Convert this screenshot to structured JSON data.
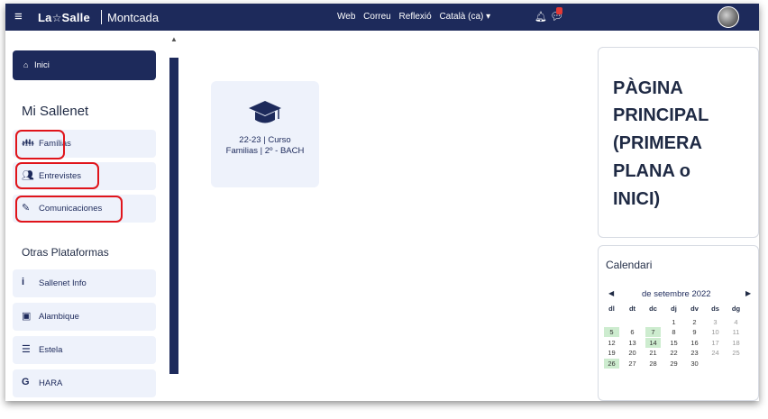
{
  "topbar": {
    "menu_icon": "hamburger-icon",
    "logo_prefix": "La",
    "logo_star": "☆",
    "logo_suffix": "Salle",
    "brand": "Montcada",
    "nav": [
      "Web",
      "Correu",
      "Reflexió",
      "Català (ca) ▾"
    ],
    "bell_icon": "bell-icon",
    "message_icon": "chat-icon",
    "accent": "#1d2a5b"
  },
  "sidebar": {
    "home": {
      "label": "Inici",
      "icon": "home-icon"
    },
    "section1_title": "Mi Sallenet",
    "section1_items": [
      {
        "label": "Famílias",
        "icon": "family-icon"
      },
      {
        "label": "Entrevistes",
        "icon": "people-icon"
      },
      {
        "label": "Comunicaciones",
        "icon": "communication-icon"
      }
    ],
    "section2_title": "Otras Plataformas",
    "section2_items": [
      {
        "label": "Sallenet Info",
        "icon": "info-icon"
      },
      {
        "label": "Alambique",
        "icon": "alambique-icon"
      },
      {
        "label": "Estela",
        "icon": "estela-icon"
      },
      {
        "label": "HARA",
        "icon": "hara-icon"
      }
    ],
    "highlight_color": "#e0141b"
  },
  "course": {
    "line1": "22-23 | Curso",
    "line2": "Familias | 2º - BACH",
    "icon": "graduation-cap-icon"
  },
  "title_panel": {
    "lines": [
      "PÀGINA",
      "PRINCIPAL",
      "(PRIMERA",
      "PLANA o",
      "INICI)"
    ]
  },
  "calendar": {
    "title": "Calendari",
    "month": "de setembre 2022",
    "weekdays": [
      "dl",
      "dt",
      "dc",
      "dj",
      "dv",
      "ds",
      "dg"
    ],
    "weeks": [
      [
        "",
        "",
        "",
        "1",
        "2",
        "3",
        "4"
      ],
      [
        "5",
        "6",
        "7",
        "8",
        "9",
        "10",
        "11"
      ],
      [
        "12",
        "13",
        "14",
        "15",
        "16",
        "17",
        "18"
      ],
      [
        "19",
        "20",
        "21",
        "22",
        "23",
        "24",
        "25"
      ],
      [
        "26",
        "27",
        "28",
        "29",
        "30",
        "",
        ""
      ]
    ],
    "highlighted_days": [
      "5",
      "7",
      "14",
      "26"
    ],
    "highlight_color": "#cdeccf"
  }
}
